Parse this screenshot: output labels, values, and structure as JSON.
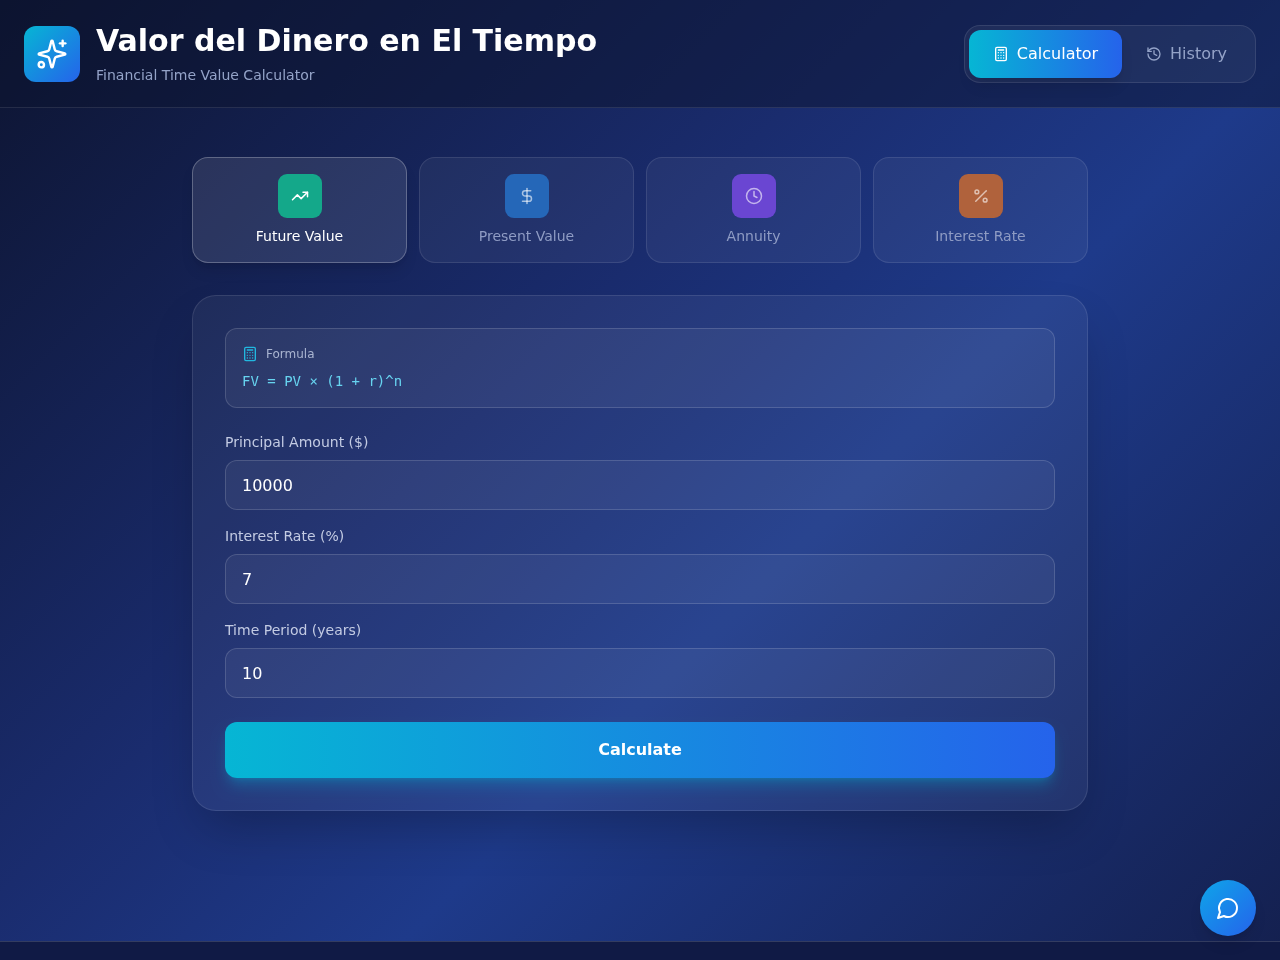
{
  "header": {
    "title": "Valor del Dinero en El Tiempo",
    "subtitle": "Financial Time Value Calculator"
  },
  "nav_tabs": [
    {
      "label": "Calculator",
      "selected": true
    },
    {
      "label": "History",
      "selected": false
    }
  ],
  "modes": [
    {
      "label": "Future Value",
      "selected": true,
      "color": "#14a88a"
    },
    {
      "label": "Present Value",
      "selected": false,
      "color": "#2567b8"
    },
    {
      "label": "Annuity",
      "selected": false,
      "color": "#6a46d2"
    },
    {
      "label": "Interest Rate",
      "selected": false,
      "color": "#b0623c"
    }
  ],
  "formula": {
    "label": "Formula",
    "expression": "FV = PV × (1 + r)^n"
  },
  "fields": [
    {
      "label": "Principal Amount ($)",
      "value": "10000"
    },
    {
      "label": "Interest Rate (%)",
      "value": "7"
    },
    {
      "label": "Time Period (years)",
      "value": "10"
    }
  ],
  "calculate_button": "Calculate"
}
